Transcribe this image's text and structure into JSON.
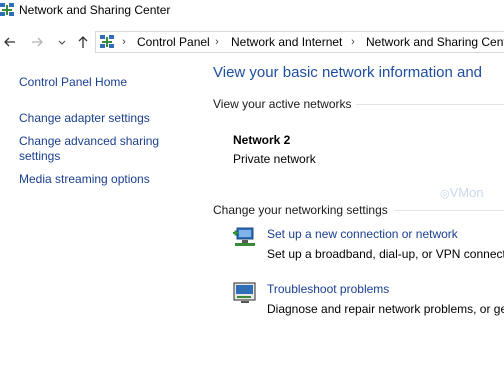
{
  "window": {
    "title": "Network and Sharing Center"
  },
  "address_bar": {
    "breadcrumbs": [
      "Control Panel",
      "Network and Internet",
      "Network and Sharing Center"
    ]
  },
  "left_pane": {
    "links": [
      "Control Panel Home",
      "Change adapter settings",
      "Change advanced sharing",
      "settings",
      "Media streaming options"
    ]
  },
  "main": {
    "title": "View your basic network information and",
    "active_networks_heading": "View your active networks",
    "network": {
      "name": "Network 2",
      "type": "Private network"
    },
    "watermark": "VMon",
    "change_settings_heading": "Change your networking settings",
    "tasks": [
      {
        "icon": "new-connection-icon",
        "link": "Set up a new connection or network",
        "description": "Set up a broadband, dial-up, or VPN connect"
      },
      {
        "icon": "troubleshoot-icon",
        "link": "Troubleshoot problems",
        "description": "Diagnose and repair network problems, or ge"
      }
    ]
  },
  "colors": {
    "link": "#1a3f8f",
    "title_blue": "#1e4e9e",
    "rule": "#e3e3e3"
  }
}
